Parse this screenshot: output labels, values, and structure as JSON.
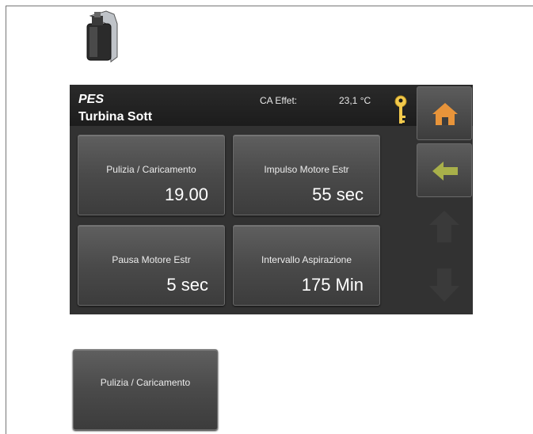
{
  "header": {
    "title": "PES",
    "subtitle": "Turbina Sott",
    "reading_label": "CA Effet:",
    "reading_value": "23,1 °C"
  },
  "tiles": [
    {
      "label": "Pulizia / Caricamento",
      "value": "19.00"
    },
    {
      "label": "Impulso Motore Estr",
      "value": "55 sec"
    },
    {
      "label": "Pausa Motore Estr",
      "value": "5 sec"
    },
    {
      "label": "Intervallo Aspirazione",
      "value": "175 Min"
    }
  ],
  "standalone_tile": {
    "label": "Pulizia / Caricamento"
  },
  "icons": {
    "device": "device-icon",
    "key": "key-icon",
    "home": "home-icon",
    "back": "arrow-left-icon",
    "up": "arrow-up-icon",
    "down": "arrow-down-icon"
  },
  "colors": {
    "panel_bg": "#323232",
    "home_icon": "#e8943a",
    "back_icon": "#a8b04a",
    "key_icon": "#f2c94c"
  }
}
